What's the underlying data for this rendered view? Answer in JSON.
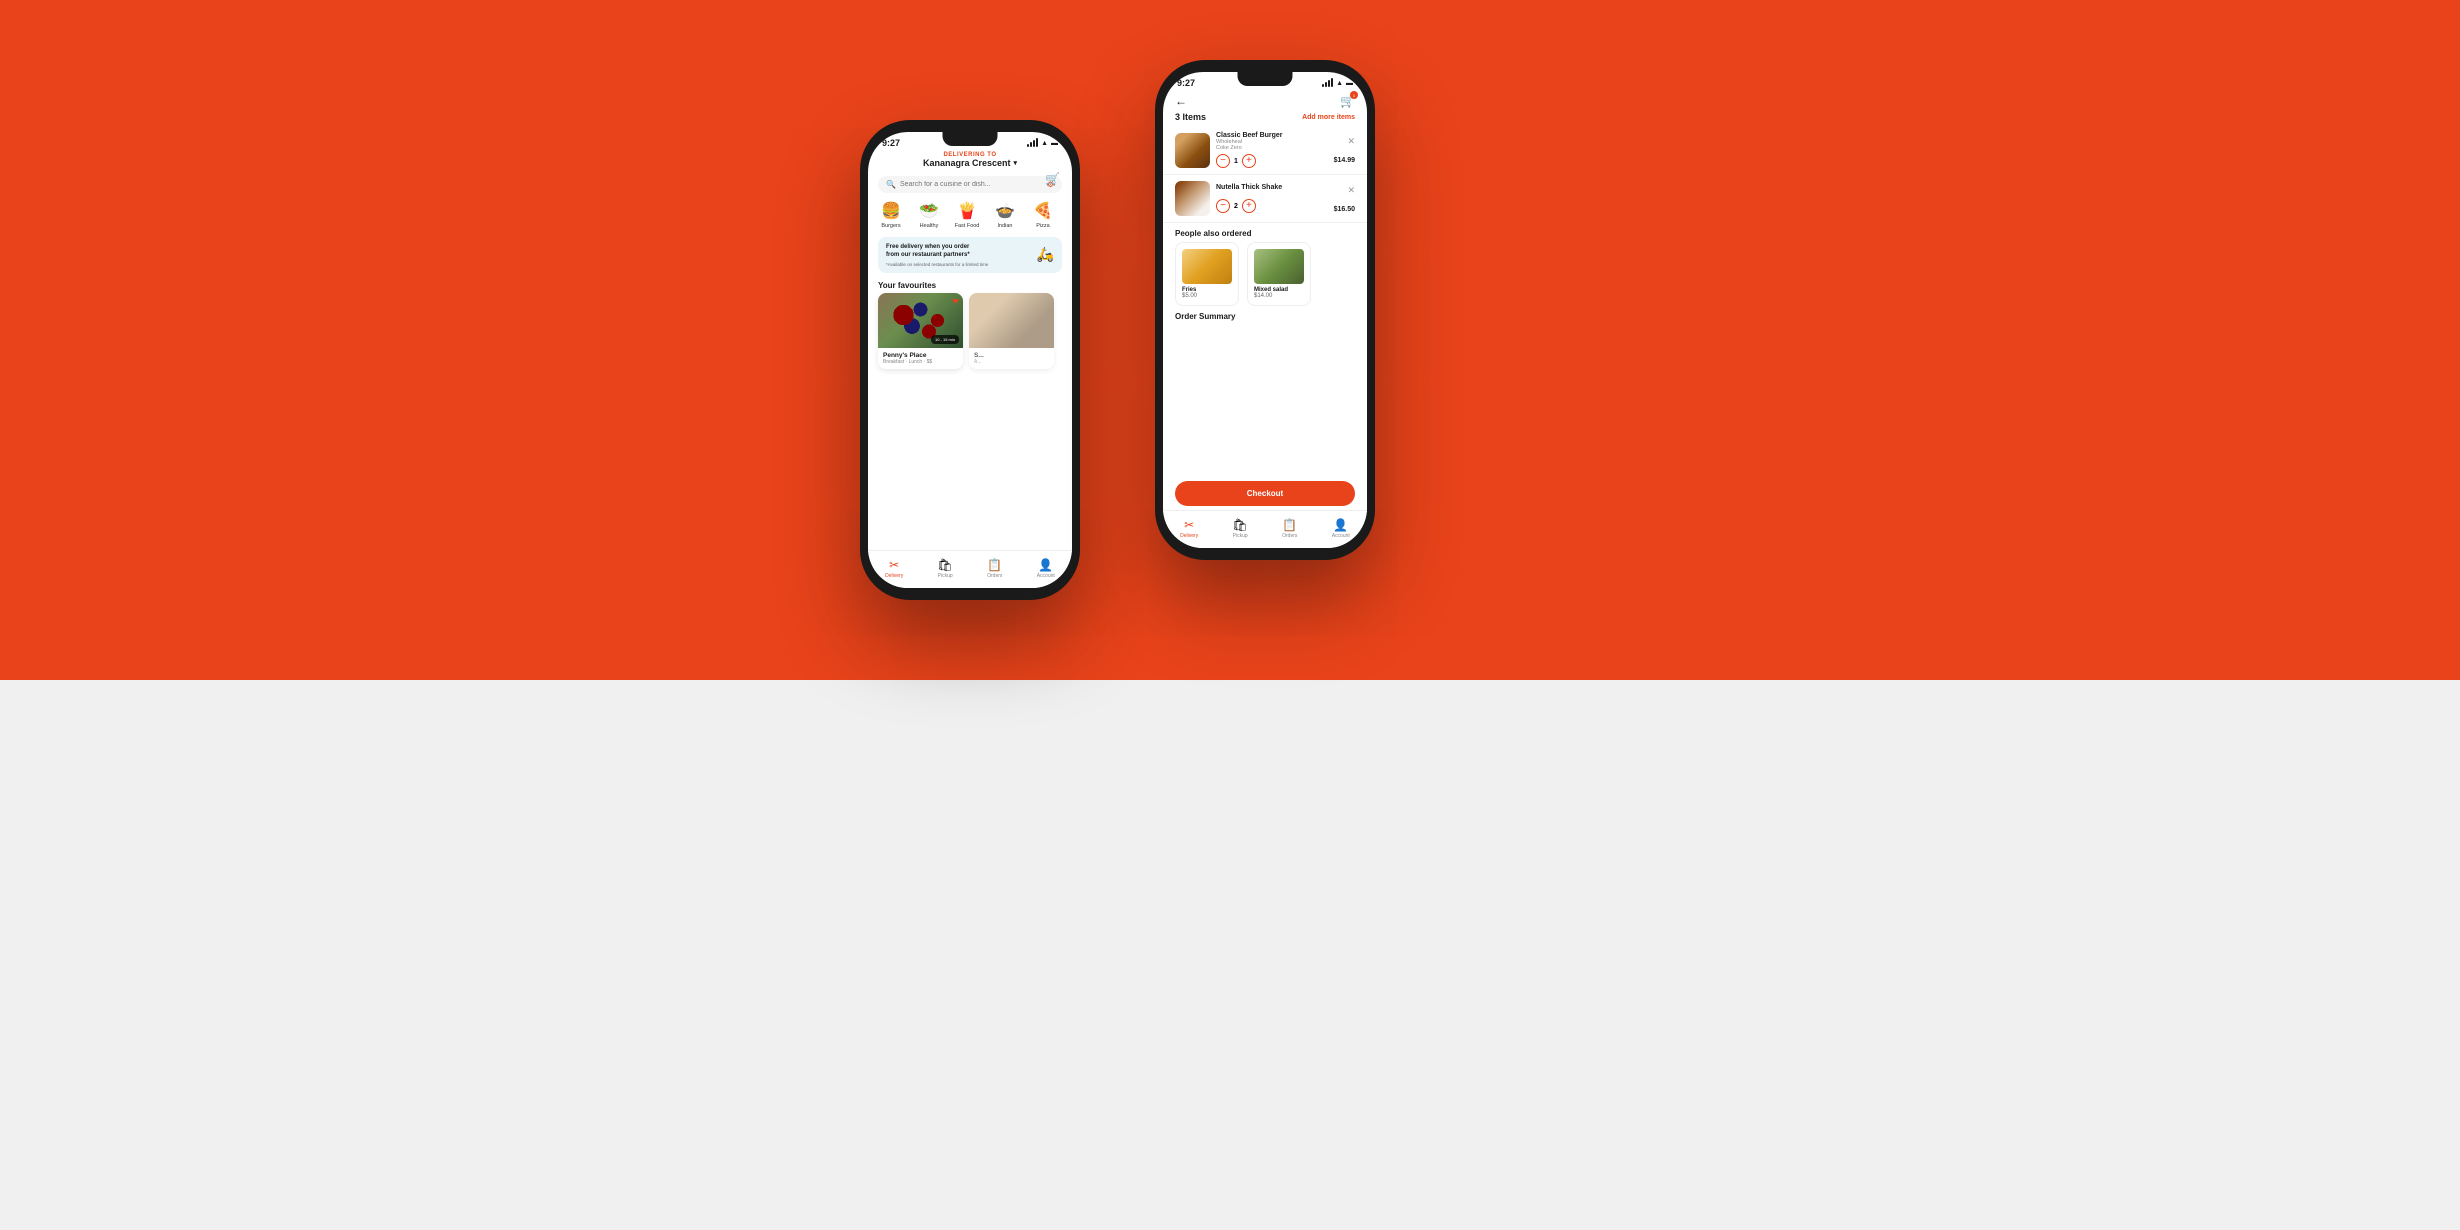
{
  "background": {
    "top_color": "#E8431A",
    "bottom_color": "#f0f0f0"
  },
  "phone1": {
    "status_bar": {
      "time": "9:27",
      "signal": "●●●",
      "wifi": "wifi",
      "battery": "battery"
    },
    "header": {
      "delivering_label": "DELIVERING TO",
      "location": "Kananagra Crescent",
      "chevron": "▾"
    },
    "search": {
      "placeholder": "Search for a cuisine or dish..."
    },
    "categories": [
      {
        "emoji": "🍔",
        "label": "Burgers"
      },
      {
        "emoji": "🥗",
        "label": "Healthy"
      },
      {
        "emoji": "🍟",
        "label": "Fast Food"
      },
      {
        "emoji": "🍲",
        "label": "Indian"
      },
      {
        "emoji": "🍕",
        "label": "Pizza"
      }
    ],
    "promo": {
      "title": "Free delivery when you order\nfrom our restaurant partners*",
      "subtitle": "*Available on selected restaurants for a limited time",
      "icon": "🛵"
    },
    "favourites": {
      "section_title": "Your favourites",
      "items": [
        {
          "name": "Penny's Place",
          "subtitle": "Breakfast · Lunch · $$",
          "time_badge": "10 - 15 min",
          "hearted": true
        },
        {
          "name": "S...",
          "subtitle": "A...",
          "hearted": false
        }
      ]
    },
    "bottom_nav": [
      {
        "icon": "🍴",
        "label": "Delivery",
        "active": true
      },
      {
        "icon": "🛍",
        "label": "Pickup",
        "active": false
      },
      {
        "icon": "📋",
        "label": "Orders",
        "active": false
      },
      {
        "icon": "👤",
        "label": "Account",
        "active": false
      }
    ]
  },
  "phone2": {
    "status_bar": {
      "time": "9:27"
    },
    "header": {
      "back_icon": "←",
      "cart_badge": "1"
    },
    "items_header": {
      "count": "3 Items",
      "add_more": "Add more items"
    },
    "cart_items": [
      {
        "name": "Classic Beef Burger",
        "sub1": "Wholeheal",
        "sub2": "Coke Zero",
        "quantity": 1,
        "price": "$14.99"
      },
      {
        "name": "Nutella Thick Shake",
        "sub1": "",
        "sub2": "",
        "quantity": 2,
        "price": "$16.50"
      }
    ],
    "people_also_ordered": {
      "title": "People also ordered",
      "items": [
        {
          "name": "Fries",
          "price": "$5.00"
        },
        {
          "name": "Mixed salad",
          "price": "$14.00"
        }
      ]
    },
    "order_summary": {
      "title": "Order Summary"
    },
    "checkout": {
      "label": "Checkout"
    },
    "bottom_nav": [
      {
        "icon": "🍴",
        "label": "Delivery",
        "active": true
      },
      {
        "icon": "🛍",
        "label": "Pickup",
        "active": false
      },
      {
        "icon": "📋",
        "label": "Orders",
        "active": false
      },
      {
        "icon": "👤",
        "label": "Account",
        "active": false
      }
    ]
  }
}
